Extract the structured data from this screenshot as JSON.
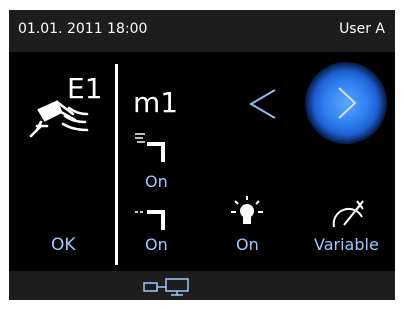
{
  "status_bar": {
    "datetime": "01.01. 2011 18:00",
    "user": "User A"
  },
  "left_panel": {
    "tool_label": "E1",
    "ok_label": "OK"
  },
  "mode": {
    "label": "m1"
  },
  "spray_settings": {
    "air_state": "On",
    "water_state": "On"
  },
  "light": {
    "state": "On"
  },
  "speed": {
    "mode": "Variable"
  },
  "icons": {
    "tool": "handpiece-icon",
    "nav_prev": "chevron-left-icon",
    "nav_next": "chevron-right-icon",
    "air": "spray-air-icon",
    "water": "spray-water-icon",
    "light": "light-bulb-icon",
    "speed": "speedometer-icon",
    "footer": "device-connection-icon"
  },
  "colors": {
    "accent": "#9ec7ff",
    "background": "#000000",
    "bar": "#1d1d1d",
    "glow": "#3a8cff"
  }
}
